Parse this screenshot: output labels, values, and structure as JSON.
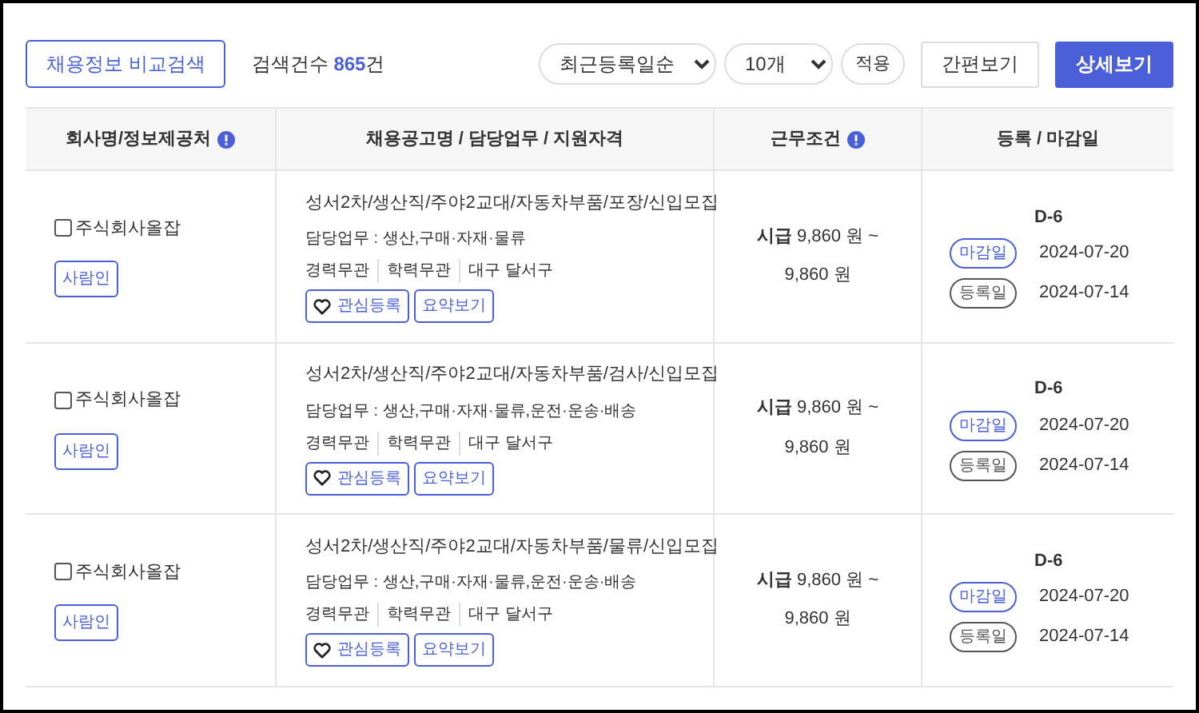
{
  "toolbar": {
    "compare_button": "채용정보 비교검색",
    "count_label": "검색건수",
    "count": "865",
    "count_unit": "건",
    "sort_select": {
      "value": "최근등록일순"
    },
    "size_select": {
      "value": "10개"
    },
    "apply_button": "적용",
    "view_buttons": [
      {
        "label": "간편보기",
        "selected": false
      },
      {
        "label": "상세보기",
        "selected": true
      }
    ]
  },
  "table": {
    "columns": [
      {
        "label": "회사명/정보제공처",
        "info": true
      },
      {
        "label": "채용공고명 / 담당업무 / 지원자격",
        "info": false
      },
      {
        "label": "근무조건",
        "info": true
      },
      {
        "label": "등록 / 마감일",
        "info": false
      }
    ],
    "rows": [
      {
        "company": "주식회사올잡",
        "checked": false,
        "source": "사람인",
        "title": "성서2차/생산직/주야2교대/자동차부품/포장/신입모집",
        "duty": "담당업무 : 생산,구매·자재·물류",
        "tags": [
          "경력무관",
          "학력무관",
          "대구 달서구"
        ],
        "like_button": "관심등록",
        "summary_button": "요약보기",
        "pay_line1": "**시급** 9,860 원 ~",
        "pay_line2": "9,860 원",
        "dday": "D-6",
        "deadline_label": "마감일",
        "deadline": "2024-07-20",
        "registered_label": "등록일",
        "registered": "2024-07-14"
      },
      {
        "company": "주식회사올잡",
        "checked": false,
        "source": "사람인",
        "title": "성서2차/생산직/주야2교대/자동차부품/검사/신입모집",
        "duty": "담당업무 : 생산,구매·자재·물류,운전·운송·배송",
        "tags": [
          "경력무관",
          "학력무관",
          "대구 달서구"
        ],
        "like_button": "관심등록",
        "summary_button": "요약보기",
        "pay_line1": "**시급** 9,860 원 ~",
        "pay_line2": "9,860 원",
        "dday": "D-6",
        "deadline_label": "마감일",
        "deadline": "2024-07-20",
        "registered_label": "등록일",
        "registered": "2024-07-14"
      },
      {
        "company": "주식회사올잡",
        "checked": false,
        "source": "사람인",
        "title": "성서2차/생산직/주야2교대/자동차부품/물류/신입모집",
        "duty": "담당업무 : 생산,구매·자재·물류,운전·운송·배송",
        "tags": [
          "경력무관",
          "학력무관",
          "대구 달서구"
        ],
        "like_button": "관심등록",
        "summary_button": "요약보기",
        "pay_line1": "**시급** 9,860 원 ~",
        "pay_line2": "9,860 원",
        "dday": "D-6",
        "deadline_label": "마감일",
        "deadline": "2024-07-20",
        "registered_label": "등록일",
        "registered": "2024-07-14"
      }
    ]
  }
}
